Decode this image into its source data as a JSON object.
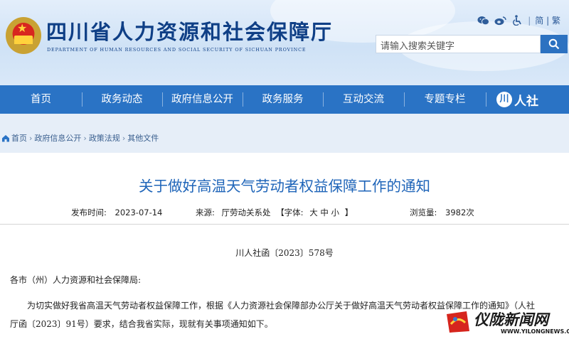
{
  "header": {
    "site_title": "四川省人力资源和社会保障厅",
    "site_subtitle": "DEPARTMENT OF HUMAN RESOURCES AND SOCIAL SECURITY OF SICHUAN PROVINCE",
    "icons": [
      "wechat-icon",
      "weibo-icon",
      "accessibility-icon"
    ],
    "lang_simplified": "简",
    "lang_separator": "|",
    "lang_traditional": "繁",
    "search_placeholder": "请输入搜索关键字"
  },
  "nav": {
    "items": [
      "首页",
      "政务动态",
      "政府信息公开",
      "政务服务",
      "互动交流",
      "专题专栏"
    ],
    "logo_text": "人社"
  },
  "breadcrumb": {
    "items": [
      "首页",
      "政府信息公开",
      "政策法规",
      "其他文件"
    ],
    "separator": "›"
  },
  "article": {
    "title": "关于做好高温天气劳动者权益保障工作的通知",
    "published_label": "发布时间:",
    "published_date": "2023-07-14",
    "source_label": "来源:",
    "source_value": "厅劳动关系处",
    "font_label": "【字体:",
    "font_large": "大",
    "font_medium": "中",
    "font_small": "小",
    "font_close": "】",
    "views_label": "浏览量:",
    "views_value": "3982次",
    "doc_number": "川人社函〔2023〕578号",
    "salutation": "各市（州）人力资源和社会保障局:",
    "body_line1": "为切实做好我省高温天气劳动者权益保障工作，根据《人力资源社会保障部办公厅关于做好高温天气劳动者权益保障工作的通知》（人社",
    "body_line2": "厅函〔2023〕91号）要求，结合我省实际，现就有关事项通知如下。"
  },
  "watermark": {
    "title": "仪陇新闻网",
    "url": "WWW.YILONGNEWS.COM"
  },
  "colors": {
    "nav_blue": "#2a73c5",
    "title_blue": "#1f65b9",
    "header_navy": "#0f3f86"
  }
}
